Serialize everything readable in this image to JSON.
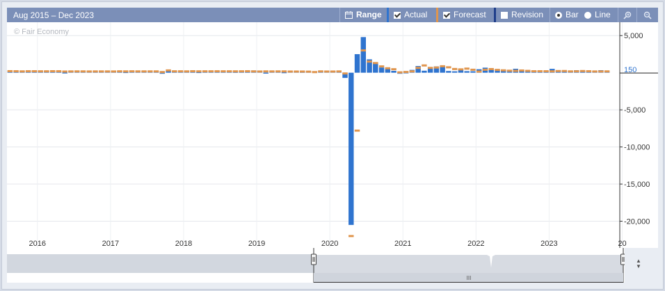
{
  "toolbar": {
    "date_range": "Aug 2015 – Dec 2023",
    "range_label": "Range",
    "actual_label": "Actual",
    "forecast_label": "Forecast",
    "revision_label": "Revision",
    "bar_label": "Bar",
    "line_label": "Line",
    "actual_checked": true,
    "forecast_checked": true,
    "revision_checked": false,
    "chart_style": "Bar",
    "icons": [
      "calendar-icon",
      "zoom-in-icon",
      "zoom-out-icon"
    ]
  },
  "watermark": "© Fair Economy",
  "colors": {
    "actual": "#2f74cf",
    "forecast": "#e0954d",
    "revision": "#1f3e8a",
    "toolbar_bg": "#7b8fb8",
    "last_value_line": "#222222"
  },
  "chart_data": {
    "type": "bar",
    "ylim": [
      -23600,
      6800
    ],
    "yticks": [
      {
        "value": 5000,
        "label": "5,000"
      },
      {
        "value": -5000,
        "label": "-5,000"
      },
      {
        "value": -10000,
        "label": "-10,000"
      },
      {
        "value": -15000,
        "label": "-15,000"
      },
      {
        "value": -20000,
        "label": "-20,000"
      }
    ],
    "last_value": {
      "value": 150,
      "label": "150"
    },
    "xlim": [
      "2015-08",
      "2023-12"
    ],
    "xticks": [
      "2016",
      "2017",
      "2018",
      "2019",
      "2020",
      "2021",
      "2022",
      "2023",
      "20"
    ],
    "grid": true,
    "series": [
      {
        "name": "Actual",
        "type": "bar"
      },
      {
        "name": "Forecast",
        "type": "marker"
      }
    ],
    "monthly": [
      {
        "x": "2015-08",
        "actual": 150,
        "forecast": 210
      },
      {
        "x": "2015-09",
        "actual": 140,
        "forecast": 200
      },
      {
        "x": "2015-10",
        "actual": 270,
        "forecast": 180
      },
      {
        "x": "2015-11",
        "actual": 210,
        "forecast": 200
      },
      {
        "x": "2015-12",
        "actual": 290,
        "forecast": 200
      },
      {
        "x": "2016-01",
        "actual": 150,
        "forecast": 190
      },
      {
        "x": "2016-02",
        "actual": 240,
        "forecast": 190
      },
      {
        "x": "2016-03",
        "actual": 210,
        "forecast": 205
      },
      {
        "x": "2016-04",
        "actual": 160,
        "forecast": 200
      },
      {
        "x": "2016-05",
        "actual": 40,
        "forecast": 160
      },
      {
        "x": "2016-06",
        "actual": 280,
        "forecast": 175
      },
      {
        "x": "2016-07",
        "actual": 260,
        "forecast": 180
      },
      {
        "x": "2016-08",
        "actual": 150,
        "forecast": 180
      },
      {
        "x": "2016-09",
        "actual": 160,
        "forecast": 170
      },
      {
        "x": "2016-10",
        "actual": 160,
        "forecast": 175
      },
      {
        "x": "2016-11",
        "actual": 180,
        "forecast": 175
      },
      {
        "x": "2016-12",
        "actual": 160,
        "forecast": 175
      },
      {
        "x": "2017-01",
        "actual": 230,
        "forecast": 170
      },
      {
        "x": "2017-02",
        "actual": 230,
        "forecast": 190
      },
      {
        "x": "2017-03",
        "actual": 100,
        "forecast": 180
      },
      {
        "x": "2017-04",
        "actual": 210,
        "forecast": 190
      },
      {
        "x": "2017-05",
        "actual": 140,
        "forecast": 180
      },
      {
        "x": "2017-06",
        "actual": 220,
        "forecast": 180
      },
      {
        "x": "2017-07",
        "actual": 210,
        "forecast": 180
      },
      {
        "x": "2017-08",
        "actual": 160,
        "forecast": 180
      },
      {
        "x": "2017-09",
        "actual": -30,
        "forecast": 90
      },
      {
        "x": "2017-10",
        "actual": 260,
        "forecast": 310
      },
      {
        "x": "2017-11",
        "actual": 230,
        "forecast": 190
      },
      {
        "x": "2017-12",
        "actual": 150,
        "forecast": 190
      },
      {
        "x": "2018-01",
        "actual": 200,
        "forecast": 180
      },
      {
        "x": "2018-02",
        "actual": 310,
        "forecast": 200
      },
      {
        "x": "2018-03",
        "actual": 100,
        "forecast": 185
      },
      {
        "x": "2018-04",
        "actual": 160,
        "forecast": 190
      },
      {
        "x": "2018-05",
        "actual": 220,
        "forecast": 190
      },
      {
        "x": "2018-06",
        "actual": 210,
        "forecast": 195
      },
      {
        "x": "2018-07",
        "actual": 160,
        "forecast": 190
      },
      {
        "x": "2018-08",
        "actual": 200,
        "forecast": 190
      },
      {
        "x": "2018-09",
        "actual": 130,
        "forecast": 185
      },
      {
        "x": "2018-10",
        "actual": 250,
        "forecast": 190
      },
      {
        "x": "2018-11",
        "actual": 160,
        "forecast": 200
      },
      {
        "x": "2018-12",
        "actual": 310,
        "forecast": 180
      },
      {
        "x": "2019-01",
        "actual": 300,
        "forecast": 165
      },
      {
        "x": "2019-02",
        "actual": 20,
        "forecast": 180
      },
      {
        "x": "2019-03",
        "actual": 200,
        "forecast": 175
      },
      {
        "x": "2019-04",
        "actual": 260,
        "forecast": 180
      },
      {
        "x": "2019-05",
        "actual": 80,
        "forecast": 180
      },
      {
        "x": "2019-06",
        "actual": 220,
        "forecast": 160
      },
      {
        "x": "2019-07",
        "actual": 160,
        "forecast": 160
      },
      {
        "x": "2019-08",
        "actual": 130,
        "forecast": 160
      },
      {
        "x": "2019-09",
        "actual": 140,
        "forecast": 145
      },
      {
        "x": "2019-10",
        "actual": 130,
        "forecast": 85
      },
      {
        "x": "2019-11",
        "actual": 260,
        "forecast": 180
      },
      {
        "x": "2019-12",
        "actual": 140,
        "forecast": 160
      },
      {
        "x": "2020-01",
        "actual": 220,
        "forecast": 160
      },
      {
        "x": "2020-02",
        "actual": 270,
        "forecast": 175
      },
      {
        "x": "2020-03",
        "actual": -700,
        "forecast": -100
      },
      {
        "x": "2020-04",
        "actual": -20500,
        "forecast": -22000
      },
      {
        "x": "2020-05",
        "actual": 2500,
        "forecast": -7800
      },
      {
        "x": "2020-06",
        "actual": 4800,
        "forecast": 3000
      },
      {
        "x": "2020-07",
        "actual": 1800,
        "forecast": 1500
      },
      {
        "x": "2020-08",
        "actual": 1400,
        "forecast": 1300
      },
      {
        "x": "2020-09",
        "actual": 700,
        "forecast": 850
      },
      {
        "x": "2020-10",
        "actual": 600,
        "forecast": 600
      },
      {
        "x": "2020-11",
        "actual": 250,
        "forecast": 470
      },
      {
        "x": "2020-12",
        "actual": -140,
        "forecast": 50
      },
      {
        "x": "2021-01",
        "actual": 50,
        "forecast": 100
      },
      {
        "x": "2021-02",
        "actual": 380,
        "forecast": 180
      },
      {
        "x": "2021-03",
        "actual": 900,
        "forecast": 650
      },
      {
        "x": "2021-04",
        "actual": 270,
        "forecast": 980
      },
      {
        "x": "2021-05",
        "actual": 560,
        "forecast": 650
      },
      {
        "x": "2021-06",
        "actual": 850,
        "forecast": 700
      },
      {
        "x": "2021-07",
        "actual": 940,
        "forecast": 870
      },
      {
        "x": "2021-08",
        "actual": 230,
        "forecast": 730
      },
      {
        "x": "2021-09",
        "actual": 190,
        "forecast": 500
      },
      {
        "x": "2021-10",
        "actual": 530,
        "forecast": 450
      },
      {
        "x": "2021-11",
        "actual": 210,
        "forecast": 550
      },
      {
        "x": "2021-12",
        "actual": 200,
        "forecast": 400
      },
      {
        "x": "2022-01",
        "actual": 470,
        "forecast": 150
      },
      {
        "x": "2022-02",
        "actual": 680,
        "forecast": 400
      },
      {
        "x": "2022-03",
        "actual": 430,
        "forecast": 490
      },
      {
        "x": "2022-04",
        "actual": 430,
        "forecast": 380
      },
      {
        "x": "2022-05",
        "actual": 390,
        "forecast": 320
      },
      {
        "x": "2022-06",
        "actual": 370,
        "forecast": 270
      },
      {
        "x": "2022-07",
        "actual": 530,
        "forecast": 250
      },
      {
        "x": "2022-08",
        "actual": 320,
        "forecast": 300
      },
      {
        "x": "2022-09",
        "actual": 260,
        "forecast": 250
      },
      {
        "x": "2022-10",
        "actual": 260,
        "forecast": 200
      },
      {
        "x": "2022-11",
        "actual": 260,
        "forecast": 200
      },
      {
        "x": "2022-12",
        "actual": 220,
        "forecast": 200
      },
      {
        "x": "2023-01",
        "actual": 520,
        "forecast": 185
      },
      {
        "x": "2023-02",
        "actual": 310,
        "forecast": 225
      },
      {
        "x": "2023-03",
        "actual": 240,
        "forecast": 230
      },
      {
        "x": "2023-04",
        "actual": 250,
        "forecast": 180
      },
      {
        "x": "2023-05",
        "actual": 340,
        "forecast": 190
      },
      {
        "x": "2023-06",
        "actual": 210,
        "forecast": 225
      },
      {
        "x": "2023-07",
        "actual": 190,
        "forecast": 200
      },
      {
        "x": "2023-08",
        "actual": 190,
        "forecast": 170
      },
      {
        "x": "2023-09",
        "actual": 340,
        "forecast": 170
      },
      {
        "x": "2023-10",
        "actual": 150,
        "forecast": 180
      }
    ]
  },
  "navigator": {
    "handle_glyph": "III",
    "arrows_glyph": "▲▼"
  }
}
